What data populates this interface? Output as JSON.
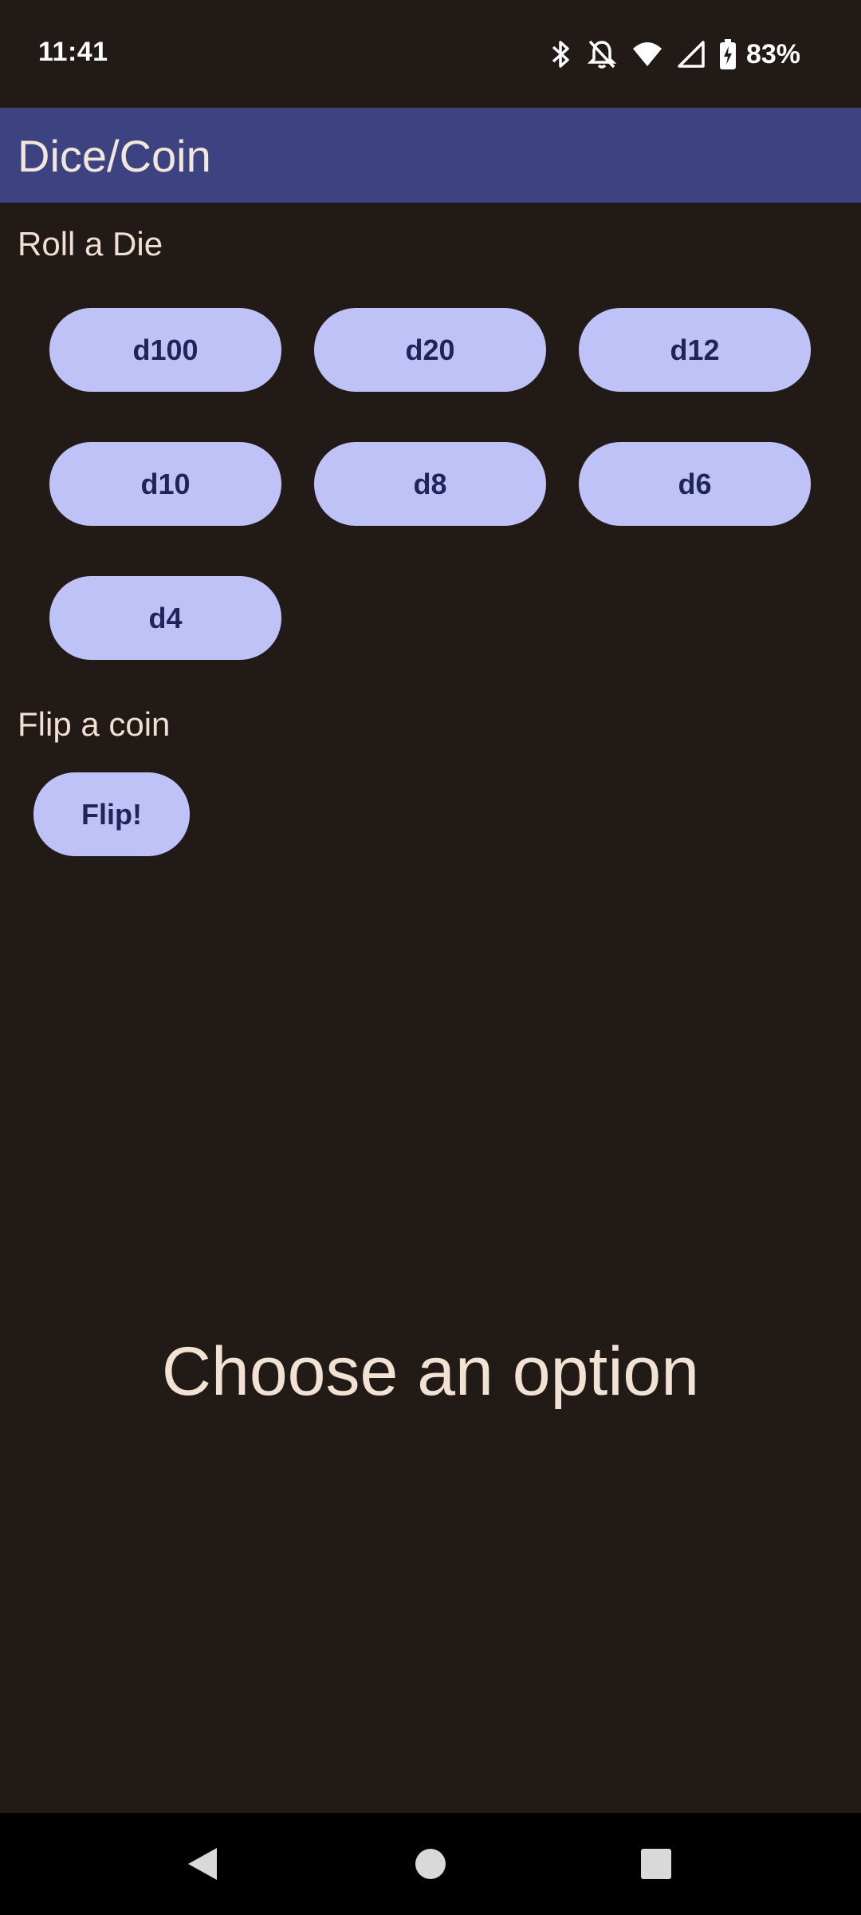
{
  "status_bar": {
    "time": "11:41",
    "icons": [
      "bluetooth-icon",
      "notifications-off-icon",
      "wifi-icon",
      "cell-signal-icon",
      "battery-charging-icon"
    ],
    "battery": "83%"
  },
  "app_bar": {
    "title": "Dice/Coin",
    "color": "#3c4380"
  },
  "dice_section": {
    "label": "Roll a Die",
    "buttons": [
      "d100",
      "d20",
      "d12",
      "d10",
      "d8",
      "d6",
      "d4"
    ]
  },
  "coin_section": {
    "label": "Flip a coin",
    "button": "Flip!"
  },
  "result": {
    "text": "Choose an option"
  },
  "nav_bar": {
    "icons": [
      "back-icon",
      "home-icon",
      "recents-icon"
    ]
  },
  "colors": {
    "background": "#221a16",
    "button_fill": "#bec2f7",
    "button_text": "#1f255a",
    "text": "#f1dfd3"
  }
}
